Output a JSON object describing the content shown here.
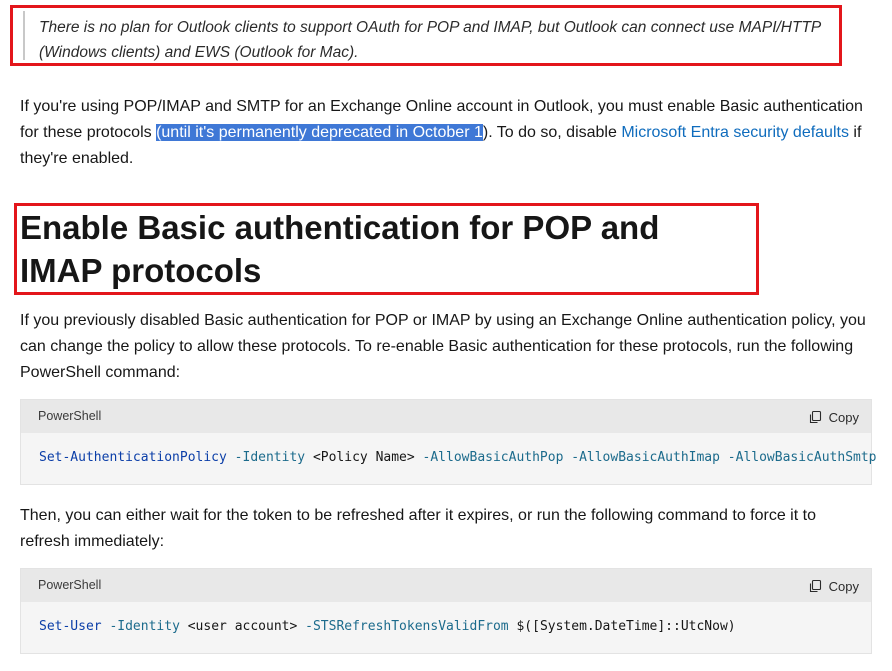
{
  "note": {
    "text": "There is no plan for Outlook clients to support OAuth for POP and IMAP, but Outlook can connect use MAPI/HTTP (Windows clients) and EWS (Outlook for Mac)."
  },
  "para1": {
    "before": "If you're using POP/IMAP and SMTP for an Exchange Online account in Outlook, you must enable Basic authentication for these protocols ",
    "highlight": "(until it's permanently deprecated in October 1",
    "middle": "). To do so, disable ",
    "link": "Microsoft Entra security defaults",
    "after": " if they're enabled."
  },
  "heading": {
    "text": "Enable Basic authentication for POP and IMAP protocols"
  },
  "para2": {
    "text": "If you previously disabled Basic authentication for POP or IMAP by using an Exchange Online authentication policy, you can change the policy to allow these protocols. To re-enable Basic authentication for these protocols, run the following PowerShell command:"
  },
  "code1": {
    "language": "PowerShell",
    "copy_label": "Copy",
    "cmd": "Set-AuthenticationPolicy",
    "p1": " -Identity",
    "ph1": " <Policy Name>",
    "p2": " -AllowBasicAuthPop",
    "p3": " -AllowBasicAuthImap",
    "p4": " -AllowBasicAuthSmtp"
  },
  "para3": {
    "text": "Then, you can either wait for the token to be refreshed after it expires, or run the following command to force it to refresh immediately:"
  },
  "code2": {
    "language": "PowerShell",
    "copy_label": "Copy",
    "cmd": "Set-User",
    "p1": " -Identity",
    "ph1": " <user account>",
    "p2": " -STSRefreshTokensValidFrom",
    "ph2": " $([System.DateTime]::UtcNow)"
  },
  "colors": {
    "annotation_border": "#e3161b",
    "selection_highlight": "#3f78d6",
    "link": "#0f6cbd"
  },
  "icons": {
    "copy": "copy-icon"
  }
}
